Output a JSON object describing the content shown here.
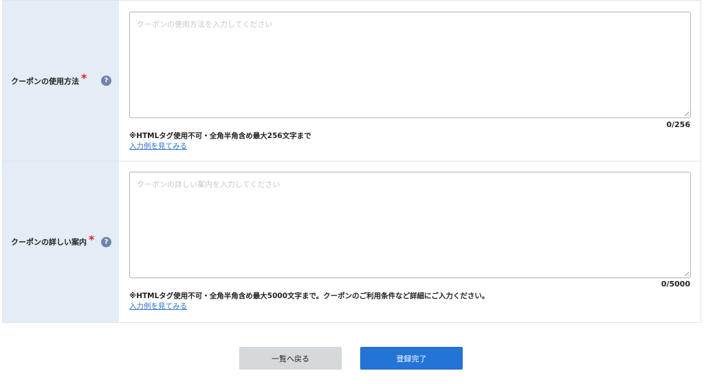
{
  "fields": [
    {
      "label": "クーポンの使用方法",
      "required_mark": "*",
      "help_icon": "?",
      "placeholder": "クーポンの使用方法を入力してください",
      "value": "",
      "counter": "0/256",
      "note": "※HTMLタグ使用不可・全角半角含め最大256文字まで",
      "example_link": "入力例を見てみる"
    },
    {
      "label": "クーポンの詳しい案内",
      "required_mark": "*",
      "help_icon": "?",
      "placeholder": "クーポンの詳しい案内を入力してください",
      "value": "",
      "counter": "0/5000",
      "note": "※HTMLタグ使用不可・全角半角含め最大5000文字まで。クーポンのご利用条件など詳細にご入力ください。",
      "example_link": "入力例を見てみる"
    }
  ],
  "buttons": {
    "back_label": "一覧へ戻る",
    "submit_label": "登録完了"
  },
  "colors": {
    "label_bg": "#e4ecf5",
    "required": "#e0241b",
    "link": "#2a6fcf",
    "primary": "#2474d8"
  }
}
